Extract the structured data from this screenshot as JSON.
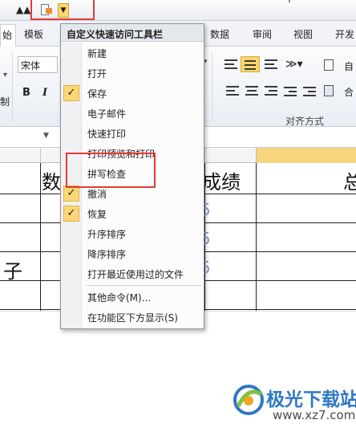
{
  "quick_access": {
    "icons": [
      "find-binoculars-icon",
      "print-preview-icon",
      "customize-dropdown-icon"
    ],
    "find_glyph": "▲▲",
    "dropdown_glyph": "▼"
  },
  "ribbon_tabs": {
    "home_fragment": "始",
    "items": [
      "模板",
      "数据",
      "审阅",
      "视图",
      "开发"
    ]
  },
  "ribbon": {
    "font_name": "宋体",
    "bold": "B",
    "italic": "I",
    "left_fragment": "制",
    "alignment_group_label": "对齐方式",
    "wrap_text_fragment": "自",
    "merge_fragment": "合"
  },
  "sheet": {
    "row1": {
      "c1": "数",
      "c2": "成绩",
      "c3": "总"
    },
    "row3": {
      "c1": "子"
    },
    "faint_digits": [
      "5",
      "5",
      "5"
    ]
  },
  "menu": {
    "header": "自定义快速访问工具栏",
    "items": [
      {
        "label": "新建",
        "checked": false
      },
      {
        "label": "打开",
        "checked": false
      },
      {
        "label": "保存",
        "checked": true
      },
      {
        "label": "电子邮件",
        "checked": false
      },
      {
        "label": "快速打印",
        "checked": false
      },
      {
        "label": "打印预览和打印",
        "checked": false
      },
      {
        "label": "拼写检查",
        "checked": false
      },
      {
        "label": "撤消",
        "checked": true
      },
      {
        "label": "恢复",
        "checked": true
      },
      {
        "label": "升序排序",
        "checked": false
      },
      {
        "label": "降序排序",
        "checked": false
      },
      {
        "label": "打开最近使用过的文件",
        "checked": false
      },
      {
        "label": "其他命令(M)...",
        "checked": false
      },
      {
        "label": "在功能区下方显示(S)",
        "checked": false
      }
    ],
    "check_glyph": "✓"
  },
  "watermark": {
    "brand": "极光下载站",
    "url": "www.xz7.com"
  },
  "colors": {
    "highlight_red": "#e53935",
    "checked_bg": "#fcd776",
    "active_column": "#f7d57c",
    "brand_blue": "#2e78c4"
  }
}
